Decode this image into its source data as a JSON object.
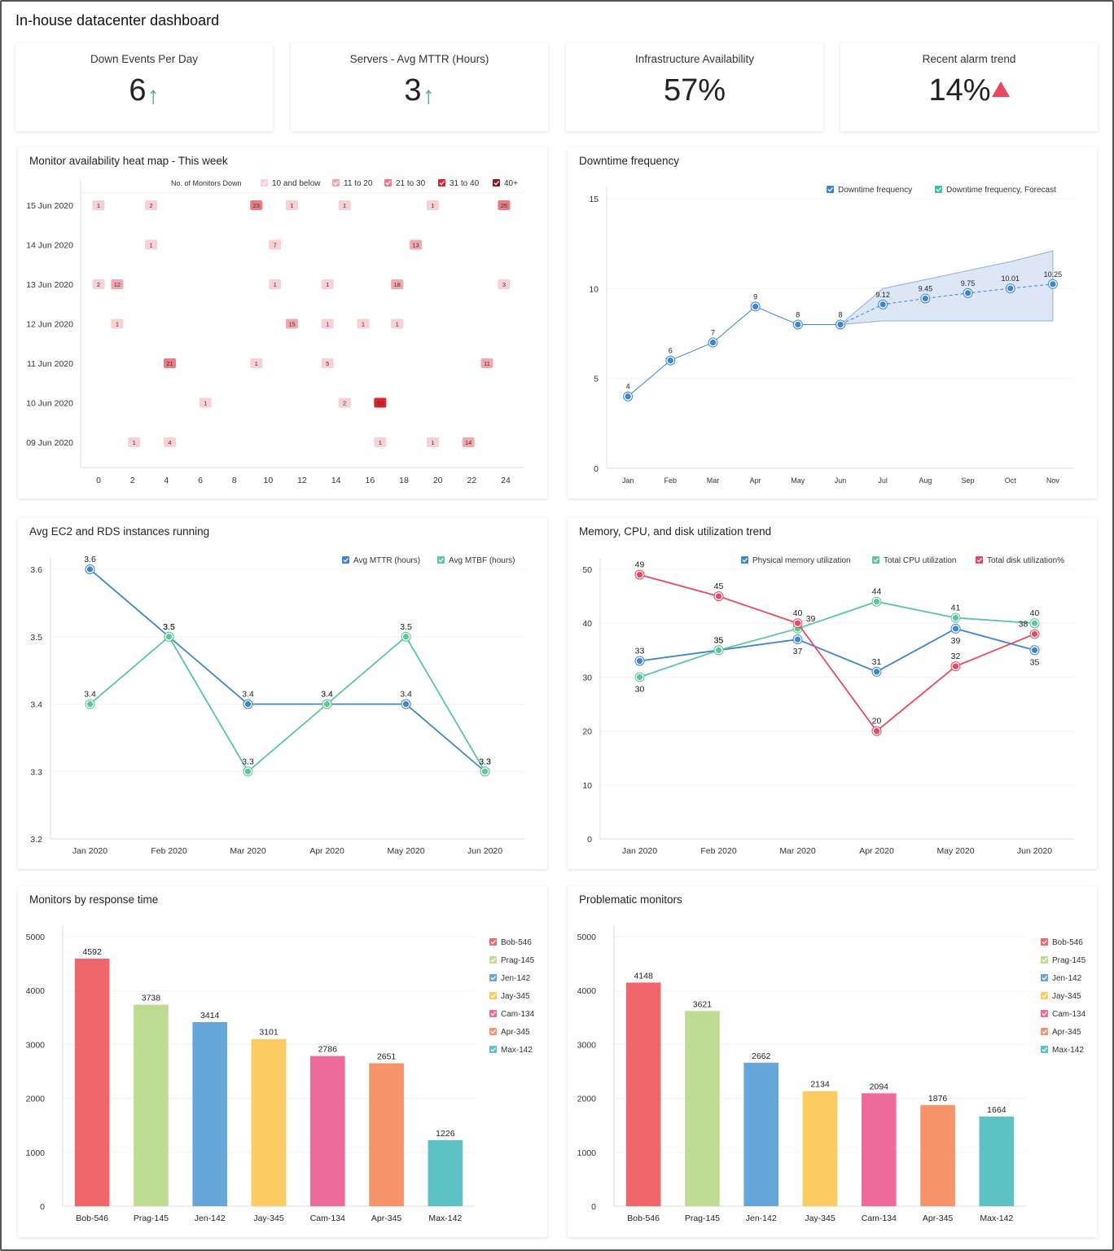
{
  "dashboard": {
    "title": "In-house datacenter dashboard"
  },
  "kpis": [
    {
      "label": "Down Events Per Day",
      "value": "6",
      "indicator": "arrow-up-icon",
      "indicator_color": "#3fb27f"
    },
    {
      "label": "Servers - Avg MTTR (Hours)",
      "value": "3",
      "indicator": "arrow-up-icon",
      "indicator_color": "#3fb27f"
    },
    {
      "label": "Infrastructure Availability",
      "value": "57%",
      "indicator": null
    },
    {
      "label": "Recent alarm trend",
      "value": "14%",
      "indicator": "triangle-up-icon",
      "indicator_color": "#e8495f"
    }
  ],
  "panels": {
    "heatmap": {
      "title": "Monitor availability heat map - This week"
    },
    "downtime": {
      "title": "Downtime frequency"
    },
    "ec2": {
      "title": "Avg EC2 and RDS instances running"
    },
    "util": {
      "title": "Memory, CPU, and disk utilization trend"
    },
    "response": {
      "title": "Monitors by response time"
    },
    "problematic": {
      "title": "Problematic monitors"
    }
  },
  "chart_data": [
    {
      "id": "heatmap",
      "type": "heatmap",
      "title": "Monitor availability heat map - This week",
      "legend_title": "No. of Monitors Down",
      "legend": [
        {
          "label": "10 and below",
          "color": "#f9d0d3"
        },
        {
          "label": "11 to 20",
          "color": "#f4a7ad"
        },
        {
          "label": "21 to 30",
          "color": "#ee7b83"
        },
        {
          "label": "31 to 40",
          "color": "#d9252f"
        },
        {
          "label": "40+",
          "color": "#8b1a1f"
        }
      ],
      "x_ticks": [
        0,
        2,
        4,
        6,
        8,
        10,
        12,
        14,
        16,
        18,
        20,
        22,
        24
      ],
      "xlim": [
        0,
        24
      ],
      "rows": [
        "15 Jun 2020",
        "14 Jun 2020",
        "13 Jun 2020",
        "12 Jun 2020",
        "11 Jun 2020",
        "10 Jun 2020",
        "09 Jun 2020"
      ],
      "cells": [
        {
          "row": "15 Jun 2020",
          "x": 0,
          "value": 1
        },
        {
          "row": "15 Jun 2020",
          "x": 3.1,
          "value": 2
        },
        {
          "row": "15 Jun 2020",
          "x": 9.3,
          "value": 23
        },
        {
          "row": "15 Jun 2020",
          "x": 11.4,
          "value": 1
        },
        {
          "row": "15 Jun 2020",
          "x": 14.5,
          "value": 1
        },
        {
          "row": "15 Jun 2020",
          "x": 19.7,
          "value": 1
        },
        {
          "row": "15 Jun 2020",
          "x": 23.9,
          "value": 25
        },
        {
          "row": "14 Jun 2020",
          "x": 3.1,
          "value": 1
        },
        {
          "row": "14 Jun 2020",
          "x": 10.4,
          "value": 7
        },
        {
          "row": "14 Jun 2020",
          "x": 18.7,
          "value": 13
        },
        {
          "row": "13 Jun 2020",
          "x": 0,
          "value": 2
        },
        {
          "row": "13 Jun 2020",
          "x": 1.1,
          "value": 12
        },
        {
          "row": "13 Jun 2020",
          "x": 10.4,
          "value": 1
        },
        {
          "row": "13 Jun 2020",
          "x": 13.5,
          "value": 1
        },
        {
          "row": "13 Jun 2020",
          "x": 17.6,
          "value": 18
        },
        {
          "row": "13 Jun 2020",
          "x": 23.9,
          "value": 3
        },
        {
          "row": "12 Jun 2020",
          "x": 1.1,
          "value": 1
        },
        {
          "row": "12 Jun 2020",
          "x": 11.4,
          "value": 15
        },
        {
          "row": "12 Jun 2020",
          "x": 13.5,
          "value": 1
        },
        {
          "row": "12 Jun 2020",
          "x": 15.6,
          "value": 1
        },
        {
          "row": "12 Jun 2020",
          "x": 17.6,
          "value": 1
        },
        {
          "row": "11 Jun 2020",
          "x": 4.2,
          "value": 21
        },
        {
          "row": "11 Jun 2020",
          "x": 9.3,
          "value": 1
        },
        {
          "row": "11 Jun 2020",
          "x": 13.5,
          "value": 5
        },
        {
          "row": "11 Jun 2020",
          "x": 22.9,
          "value": 11
        },
        {
          "row": "10 Jun 2020",
          "x": 6.3,
          "value": 1
        },
        {
          "row": "10 Jun 2020",
          "x": 14.5,
          "value": 2
        },
        {
          "row": "10 Jun 2020",
          "x": 16.6,
          "value": 33
        },
        {
          "row": "09 Jun 2020",
          "x": 2.1,
          "value": 1
        },
        {
          "row": "09 Jun 2020",
          "x": 4.2,
          "value": 4
        },
        {
          "row": "09 Jun 2020",
          "x": 16.6,
          "value": 1
        },
        {
          "row": "09 Jun 2020",
          "x": 19.7,
          "value": 1
        },
        {
          "row": "09 Jun 2020",
          "x": 21.8,
          "value": 14
        }
      ]
    },
    {
      "id": "downtime",
      "type": "line",
      "title": "Downtime frequency",
      "categories": [
        "Jan",
        "Feb",
        "Mar",
        "Apr",
        "May",
        "Jun",
        "Jul",
        "Aug",
        "Sep",
        "Oct",
        "Nov"
      ],
      "ylim": [
        0,
        15
      ],
      "y_ticks": [
        0,
        5,
        10,
        15
      ],
      "legend_position": "top-right",
      "series": [
        {
          "name": "Downtime frequency",
          "color": "#3d85d1",
          "values": [
            4,
            6,
            7,
            9,
            8,
            8,
            null,
            null,
            null,
            null,
            null
          ],
          "labels": [
            "4",
            "6",
            "7",
            "9",
            "8",
            "8"
          ]
        },
        {
          "name": "Downtime frequency, Forecast",
          "color": "#3ec1a6",
          "line_color": "#3d85d1",
          "dashed": true,
          "values": [
            null,
            null,
            null,
            null,
            null,
            8,
            9.12,
            9.45,
            9.75,
            10.01,
            10.25
          ],
          "labels": [
            "",
            "9.12",
            "9.45",
            "9.75",
            "10.01",
            "10.25"
          ]
        }
      ],
      "forecast_band": {
        "from": "Jun",
        "upper": [
          8,
          10,
          10.5,
          11,
          11.5,
          12.1
        ],
        "lower": [
          8,
          8.2,
          8.2,
          8.2,
          8.2,
          8.2
        ]
      }
    },
    {
      "id": "ec2",
      "type": "line",
      "title": "Avg EC2 and RDS instances running",
      "categories": [
        "Jan 2020",
        "Feb 2020",
        "Mar 2020",
        "Apr 2020",
        "May 2020",
        "Jun 2020"
      ],
      "ylim": [
        3.2,
        3.6
      ],
      "y_ticks": [
        3.2,
        3.3,
        3.4,
        3.5,
        3.6
      ],
      "legend_position": "top-right",
      "series": [
        {
          "name": "Avg MTTR (hours)",
          "color": "#3d85d1",
          "values": [
            3.6,
            3.5,
            3.4,
            3.4,
            3.4,
            3.3
          ]
        },
        {
          "name": "Avg MTBF (hours)",
          "color": "#5bc796",
          "values": [
            3.4,
            3.5,
            3.3,
            3.4,
            3.5,
            3.3
          ]
        }
      ]
    },
    {
      "id": "util",
      "type": "line",
      "title": "Memory, CPU, and disk utilization trend",
      "categories": [
        "Jan 2020",
        "Feb 2020",
        "Mar 2020",
        "Apr 2020",
        "May 2020",
        "Jun 2020"
      ],
      "ylim": [
        0,
        50
      ],
      "y_ticks": [
        0,
        10,
        20,
        30,
        40,
        50
      ],
      "legend_position": "top-right",
      "series": [
        {
          "name": "Physical memory utilization",
          "color": "#3d85d1",
          "values": [
            33,
            35,
            37,
            31,
            39,
            35
          ]
        },
        {
          "name": "Total CPU utilization",
          "color": "#5bc796",
          "values": [
            30,
            35,
            39,
            44,
            41,
            40
          ]
        },
        {
          "name": "Total disk utilization%",
          "color": "#e8495f",
          "values": [
            49,
            45,
            40,
            20,
            32,
            38
          ]
        }
      ]
    },
    {
      "id": "response",
      "type": "bar",
      "title": "Monitors by response time",
      "categories": [
        "Bob-546",
        "Prag-145",
        "Jen-142",
        "Jay-345",
        "Cam-134",
        "Apr-345",
        "Max-142"
      ],
      "values": [
        4592,
        3738,
        3414,
        3101,
        2786,
        2651,
        1226
      ],
      "colors": [
        "#f0666b",
        "#bfdc93",
        "#66a6d9",
        "#fccb62",
        "#ee6a9b",
        "#f6936a",
        "#5ec2c4"
      ],
      "ylim": [
        0,
        5000
      ],
      "y_ticks": [
        0,
        1000,
        2000,
        3000,
        4000,
        5000
      ],
      "legend_position": "right"
    },
    {
      "id": "problematic",
      "type": "bar",
      "title": "Problematic monitors",
      "categories": [
        "Bob-546",
        "Prag-145",
        "Jen-142",
        "Jay-345",
        "Cam-134",
        "Apr-345",
        "Max-142"
      ],
      "values": [
        4148,
        3621,
        2662,
        2134,
        2094,
        1876,
        1664
      ],
      "colors": [
        "#f0666b",
        "#bfdc93",
        "#66a6d9",
        "#fccb62",
        "#ee6a9b",
        "#f6936a",
        "#5ec2c4"
      ],
      "ylim": [
        0,
        5000
      ],
      "y_ticks": [
        0,
        1000,
        2000,
        3000,
        4000,
        5000
      ],
      "legend_position": "right"
    }
  ]
}
